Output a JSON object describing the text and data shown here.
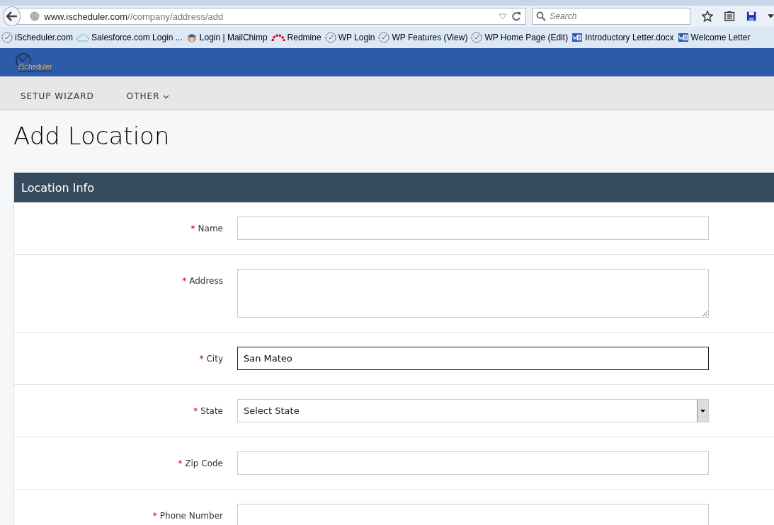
{
  "browser": {
    "url_domain": "www.ischeduler.com",
    "url_path": "//company/address/add",
    "search_placeholder": "Search"
  },
  "bookmarks": [
    {
      "label": "iScheduler.com",
      "kind": "clock"
    },
    {
      "label": "Salesforce.com Login ...",
      "kind": "cloud"
    },
    {
      "label": "Login | MailChimp",
      "kind": "chimp"
    },
    {
      "label": "Redmine",
      "kind": "redmine"
    },
    {
      "label": "WP Login",
      "kind": "clock"
    },
    {
      "label": "WP Features (View)",
      "kind": "clock"
    },
    {
      "label": "WP Home Page (Edit)",
      "kind": "clock"
    },
    {
      "label": "Introductory Letter.docx",
      "kind": "word"
    },
    {
      "label": "Welcome Letter",
      "kind": "word"
    }
  ],
  "header": {
    "logo_text": "iScheduler"
  },
  "nav": [
    {
      "label": "SETUP WIZARD",
      "dropdown": false
    },
    {
      "label": "OTHER",
      "dropdown": true
    }
  ],
  "page_title": "Add Location",
  "panel": {
    "title": "Location Info",
    "fields": [
      {
        "label": "Name",
        "required_mark": "*",
        "kind": "input",
        "focused": false
      },
      {
        "label": "Address",
        "required_mark": "*",
        "kind": "textarea",
        "focused": false
      },
      {
        "label": "City",
        "required_mark": "*",
        "kind": "input",
        "value": "San Mateo",
        "focused": true
      },
      {
        "label": "State",
        "required_mark": "*",
        "kind": "select",
        "value": "Select State",
        "focused": false
      },
      {
        "label": "Zip Code",
        "required_mark": "*",
        "kind": "input",
        "focused": false
      },
      {
        "label": "Phone Number",
        "required_mark": "*",
        "kind": "input",
        "focused": false
      }
    ]
  }
}
